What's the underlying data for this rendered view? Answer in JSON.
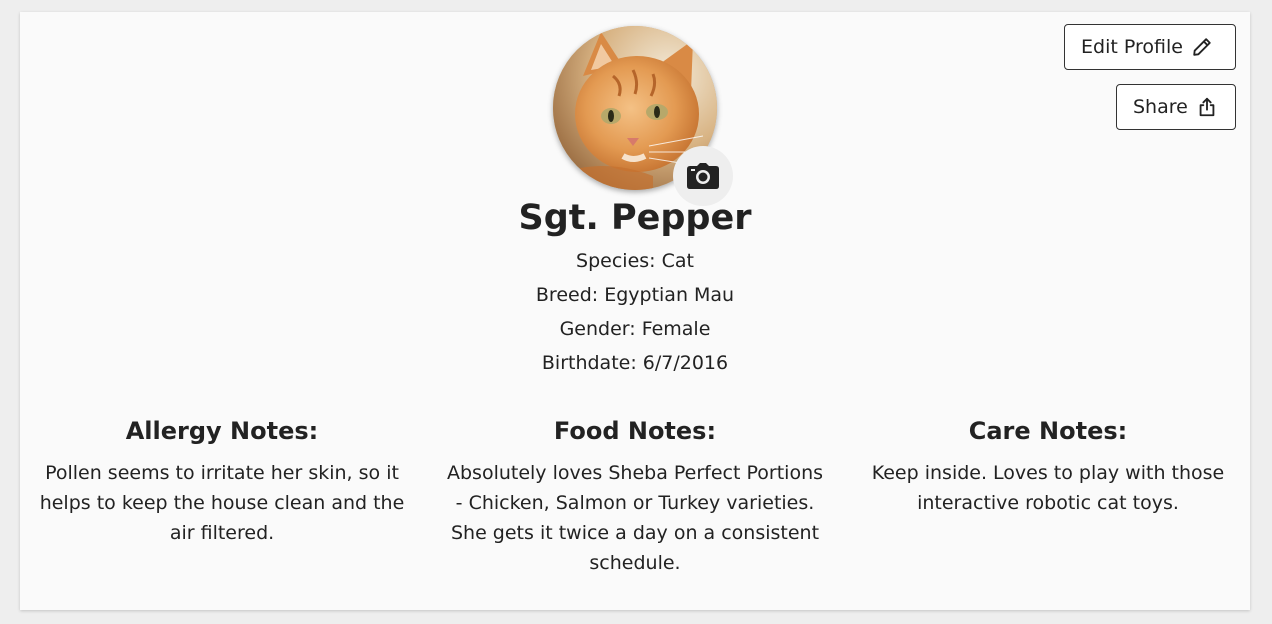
{
  "actions": {
    "edit_label": "Edit Profile",
    "edit_icon": "pencil-icon",
    "share_label": "Share",
    "share_icon": "share-icon"
  },
  "profile": {
    "photo_icon": "camera-icon",
    "name": "Sgt. Pepper",
    "species": "Species: Cat",
    "breed": "Breed: Egyptian Mau",
    "gender": "Gender: Female",
    "birthdate": "Birthdate: 6/7/2016"
  },
  "notes": {
    "allergy": {
      "title": "Allergy Notes:",
      "body": "Pollen seems to irritate her skin, so it helps to keep the house clean and the air filtered."
    },
    "food": {
      "title": "Food Notes:",
      "body": "Absolutely loves Sheba Perfect Portions - Chicken, Salmon or Turkey varieties. She gets it twice a day on a consistent schedule."
    },
    "care": {
      "title": "Care Notes:",
      "body": "Keep inside. Loves to play with those interactive robotic cat toys."
    }
  },
  "colors": {
    "page_background": "#eeeeee",
    "card_background": "#fafafa",
    "text": "#222222",
    "button_border": "#333333"
  }
}
